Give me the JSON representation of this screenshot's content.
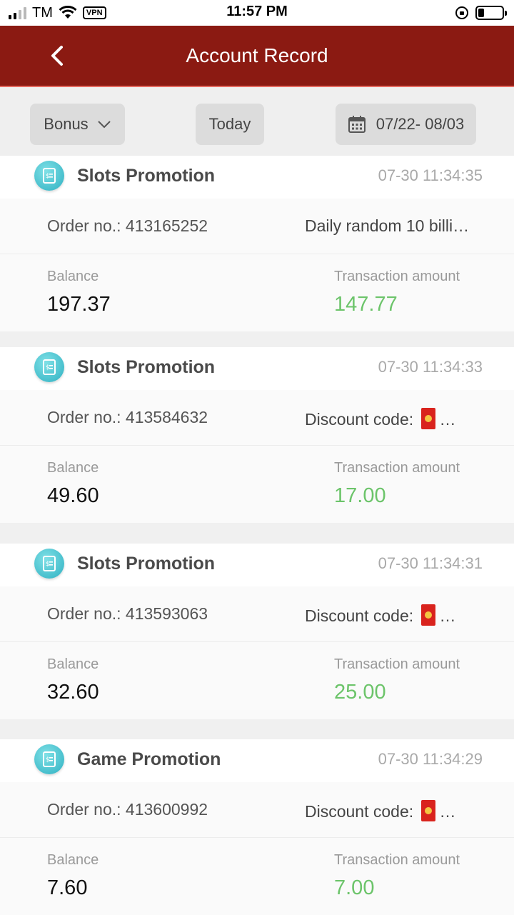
{
  "status_bar": {
    "carrier": "TM",
    "vpn": "VPN",
    "time": "11:57 PM"
  },
  "header": {
    "title": "Account Record"
  },
  "filters": {
    "type_label": "Bonus",
    "period_label": "Today",
    "date_range": "07/22- 08/03"
  },
  "labels": {
    "balance": "Balance",
    "transaction_amount": "Transaction amount"
  },
  "records": [
    {
      "title": "Slots Promotion",
      "time": "07-30 11:34:35",
      "order": "Order no.: 413165252",
      "desc": "Daily random 10 billi…",
      "balance": "197.37",
      "amount": "147.77"
    },
    {
      "title": "Slots Promotion",
      "time": "07-30 11:34:33",
      "order": "Order no.: 413584632",
      "desc": "Discount code: ",
      "balance": "49.60",
      "amount": "17.00"
    },
    {
      "title": "Slots Promotion",
      "time": "07-30 11:34:31",
      "order": "Order no.: 413593063",
      "desc": "Discount code: ",
      "balance": "32.60",
      "amount": "25.00"
    },
    {
      "title": "Game Promotion",
      "time": "07-30 11:34:29",
      "order": "Order no.: 413600992",
      "desc": "Discount code: ",
      "balance": "7.60",
      "amount": "7.00"
    }
  ],
  "colors": {
    "header_bg": "#8b1a12",
    "amount_green": "#6cc46a",
    "icon_teal": "#2fb1c2"
  }
}
